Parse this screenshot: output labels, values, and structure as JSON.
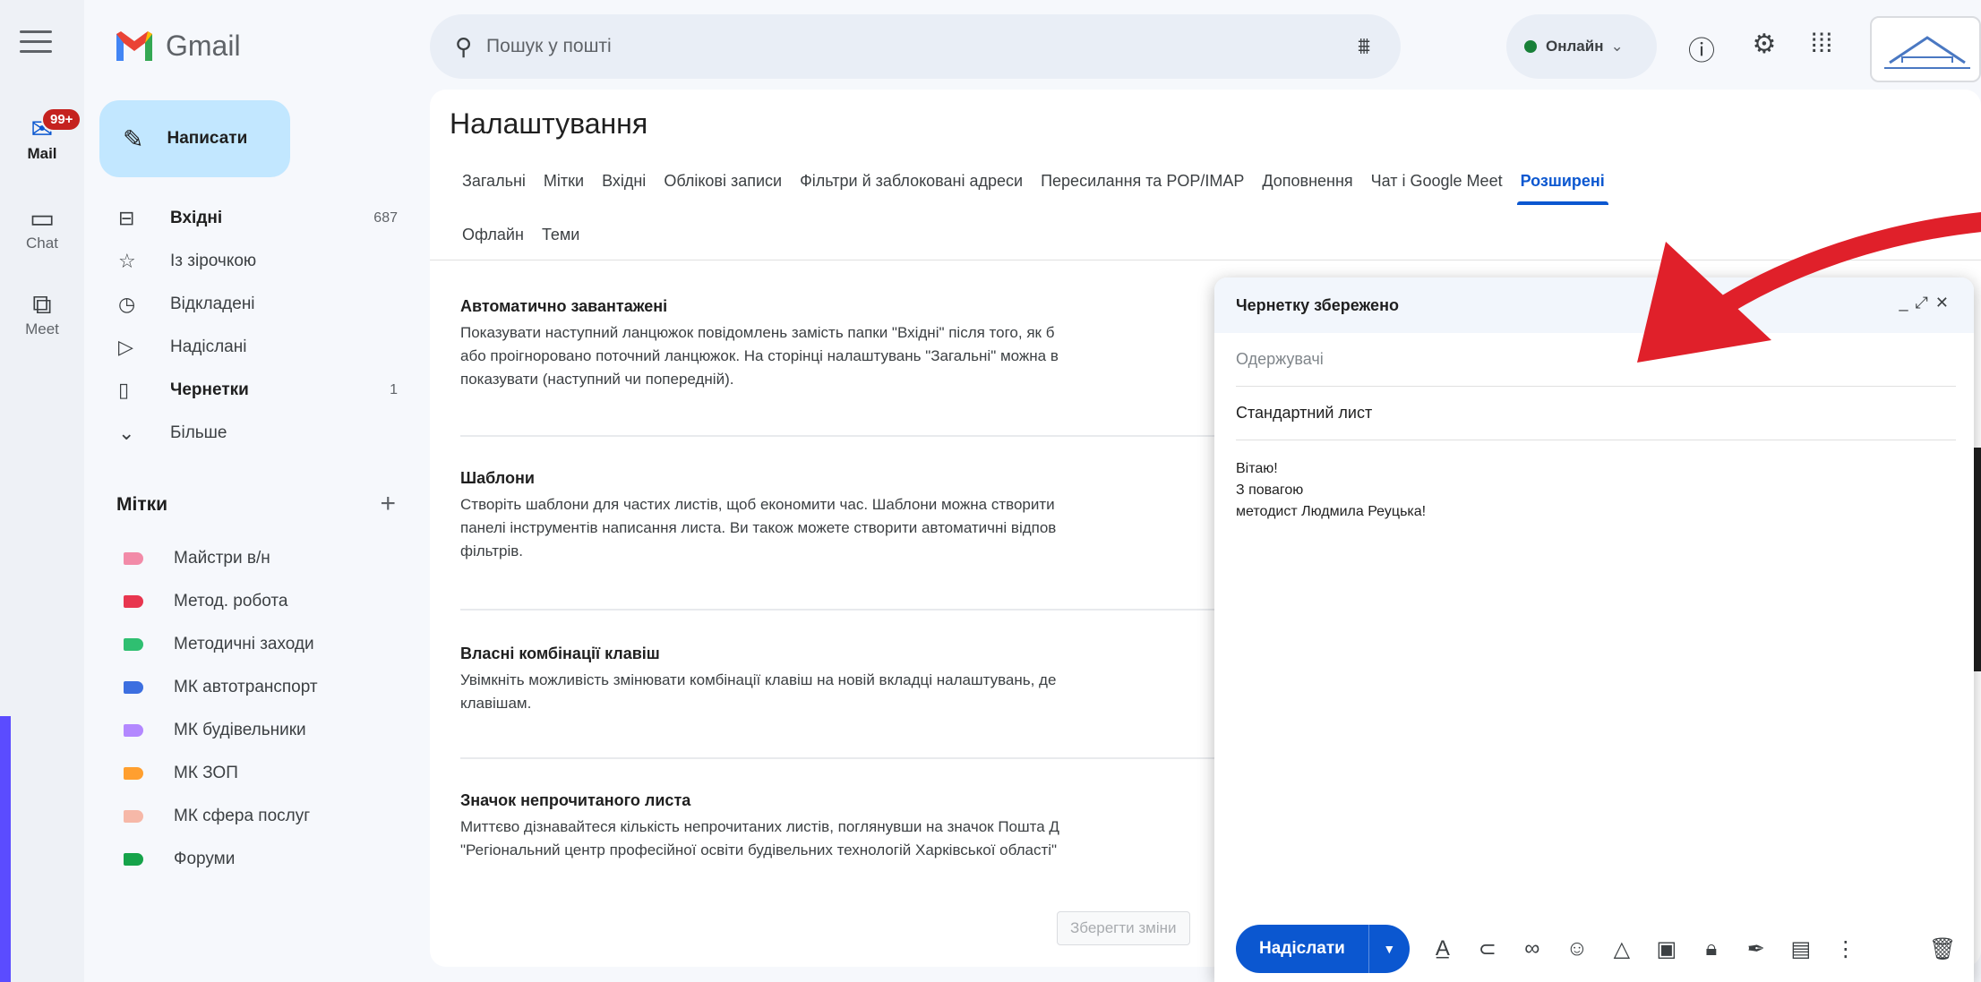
{
  "rail": {
    "badge": "99+",
    "items": [
      {
        "label": "Mail",
        "icon": "mail-icon"
      },
      {
        "label": "Chat",
        "icon": "chat-icon"
      },
      {
        "label": "Meet",
        "icon": "meet-icon"
      }
    ]
  },
  "app": {
    "name": "Gmail"
  },
  "compose_label": "Написати",
  "nav": [
    {
      "label": "Вхідні",
      "count": "687",
      "icon": "inbox-icon"
    },
    {
      "label": "Із зірочкою",
      "count": "",
      "icon": "star-icon"
    },
    {
      "label": "Відкладені",
      "count": "",
      "icon": "clock-icon"
    },
    {
      "label": "Надіслані",
      "count": "",
      "icon": "send-icon"
    },
    {
      "label": "Чернетки",
      "count": "1",
      "icon": "draft-icon"
    },
    {
      "label": "Більше",
      "count": "",
      "icon": "chevron-down-icon"
    }
  ],
  "labels": {
    "title": "Мітки",
    "items": [
      {
        "name": "Майстри в/н",
        "color": "#f28ba8"
      },
      {
        "name": "Метод. робота",
        "color": "#e8364f"
      },
      {
        "name": "Методичні заходи",
        "color": "#2fbf71"
      },
      {
        "name": "МК автотранспорт",
        "color": "#3c6fe0"
      },
      {
        "name": "МК будівельники",
        "color": "#b388ff"
      },
      {
        "name": "МК ЗОП",
        "color": "#ff9f2f"
      },
      {
        "name": "МК сфера послуг",
        "color": "#f6b8a8"
      },
      {
        "name": "Форуми",
        "color": "#16a34a"
      }
    ]
  },
  "search": {
    "placeholder": "Пошук у пошті"
  },
  "status": {
    "label": "Онлайн"
  },
  "settings": {
    "title": "Налаштування",
    "tabs_row1": [
      "Загальні",
      "Мітки",
      "Вхідні",
      "Облікові записи",
      "Фільтри й заблоковані адреси",
      "Пересилання та POP/IMAP",
      "Доповнення",
      "Чат і Google Meet",
      "Розширені"
    ],
    "tabs_row2": [
      "Офлайн",
      "Теми"
    ],
    "active_tab": "Розширені",
    "sections": [
      {
        "title": "Автоматично завантажені",
        "desc": "Показувати наступний ланцюжок повідомлень замість папки \"Вхідні\" після того, як б\nабо проігноровано поточний ланцюжок. На сторінці налаштувань \"Загальні\" можна в\nпоказувати (наступний чи попередній)."
      },
      {
        "title": "Шаблони",
        "desc": "Створіть шаблони для частих листів, щоб економити час. Шаблони можна створити\nпанелі інструментів написання листа. Ви також можете створити автоматичні відпов\nфільтрів."
      },
      {
        "title": "Власні комбінації клавіш",
        "desc": "Увімкніть можливість змінювати комбінації клавіш на новій вкладці налаштувань, де\nклавішам."
      },
      {
        "title": "Значок непрочитаного листа",
        "desc": "Миттєво дізнавайтеся кількість непрочитаних листів, поглянувши на значок Пошта Д\n\"Регіональний центр професійної освіти будівельних технологій Харківської області\""
      }
    ],
    "save_label": "Зберегти зміни"
  },
  "draft": {
    "title": "Чернетку збережено",
    "to_placeholder": "Одержувачі",
    "subject": "Стандартний лист",
    "body_lines": [
      "Вітаю!",
      "З повагою",
      "методист Людмила Реуцька!"
    ],
    "send_label": "Надіслати"
  },
  "colors": {
    "accent": "#0b57d0",
    "compose_bg": "#c2e7ff",
    "annotation_arrow": "#e0202a"
  }
}
